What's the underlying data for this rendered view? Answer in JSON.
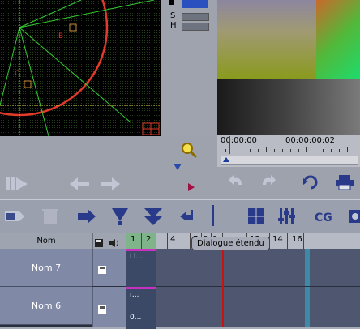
{
  "scope": {
    "label_b": "B",
    "label_c": "C"
  },
  "levels": {
    "s_label": "S",
    "h_label": "H"
  },
  "timecode": {
    "start": "00:00:00",
    "end": "00:00:00:02"
  },
  "tooltip": {
    "text": "Dialogue étendu"
  },
  "track_header": {
    "name_col": "Nom"
  },
  "ruler": {
    "ticks": [
      "1",
      "2",
      "4",
      "7",
      "8",
      "9",
      "13",
      "14",
      "16"
    ]
  },
  "tracks": [
    {
      "name": "Nom 7",
      "clip_label": "Li..."
    },
    {
      "name": "Nom 6",
      "clip_label": "r...",
      "clip_sub": "0..."
    }
  ],
  "colors": {
    "scope_red": "#e03a2a",
    "scope_green": "#33cc33",
    "playhead": "#cc1111",
    "clip_magenta": "#c830c0",
    "track_bg": "#4f5770"
  }
}
